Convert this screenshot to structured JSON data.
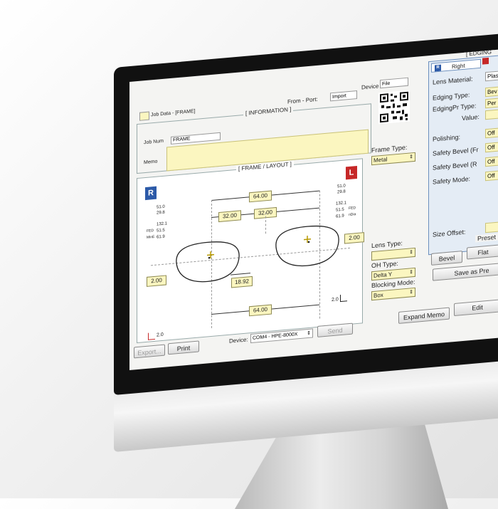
{
  "window": {
    "title": "Job Data - [FRAME]"
  },
  "information": {
    "section_title": "[ INFORMATION ]",
    "from_port_label": "From - Port:",
    "from_port_value": "Import",
    "device_label": "Device",
    "device_value": "File",
    "job_number_label": "Job Num",
    "job_number_value": "FRAME",
    "memo_label": "Memo"
  },
  "layout": {
    "section_title": "[ FRAME / LAYOUT ]",
    "right_badge": "R",
    "left_badge": "L",
    "right_meas": [
      "51.0",
      "29.8",
      "132.1",
      "51.5",
      "61.9"
    ],
    "right_meas_labels": [
      "FED",
      "MinE"
    ],
    "left_meas": [
      "51.0",
      "29.8",
      "132.1",
      "51.5",
      "61.9"
    ],
    "left_meas_labels": [
      "FED",
      "nDia"
    ],
    "top_width": "64.00",
    "half_left": "32.00",
    "half_right": "32.00",
    "bridge": "18.92",
    "bottom_width": "64.00",
    "height_left": "2.00",
    "height_right": "2.00",
    "axis_val_left": "2.0",
    "axis_val_right": "2.0"
  },
  "frame_type": {
    "label": "Frame Type:",
    "value": "Metal"
  },
  "lens_type": {
    "label": "Lens Type:",
    "value": ""
  },
  "oh_type": {
    "label": "OH Type:",
    "value": "Delta Y"
  },
  "blocking_mode": {
    "label": "Blocking Mode:",
    "value": "Box"
  },
  "bottom_bar": {
    "export": "Export...",
    "print": "Print",
    "device_label": "Device:",
    "device_value": "COM4 - HPE-8000X",
    "send": "Send",
    "expand_memo": "Expand Memo",
    "edit": "Edit"
  },
  "edging": {
    "section_title": "[ EDGING",
    "tab_right": "Right",
    "tab_right_badge": "R",
    "lens_material_label": "Lens Material:",
    "lens_material_value": "Plas",
    "edging_type_label": "Edging Type:",
    "edging_type_value": "Bev",
    "edging_pr_type_label": "EdgingPr Type:",
    "edging_pr_type_value": "Per",
    "value_label": "Value:",
    "polishing_label": "Polishing:",
    "polishing_value": "Off",
    "safety_bevel_front_label": "Safety Bevel (Fr",
    "safety_bevel_front_value": "Off",
    "safety_bevel_rear_label": "Safety Bevel (R",
    "safety_bevel_rear_value": "Off",
    "safety_mode_label": "Safety Mode:",
    "safety_mode_value": "Off",
    "size_offset_label": "Size Offset:"
  },
  "preset": {
    "title": "Preset",
    "bevel": "Bevel",
    "flat": "Flat",
    "save_as": "Save as Pre"
  }
}
